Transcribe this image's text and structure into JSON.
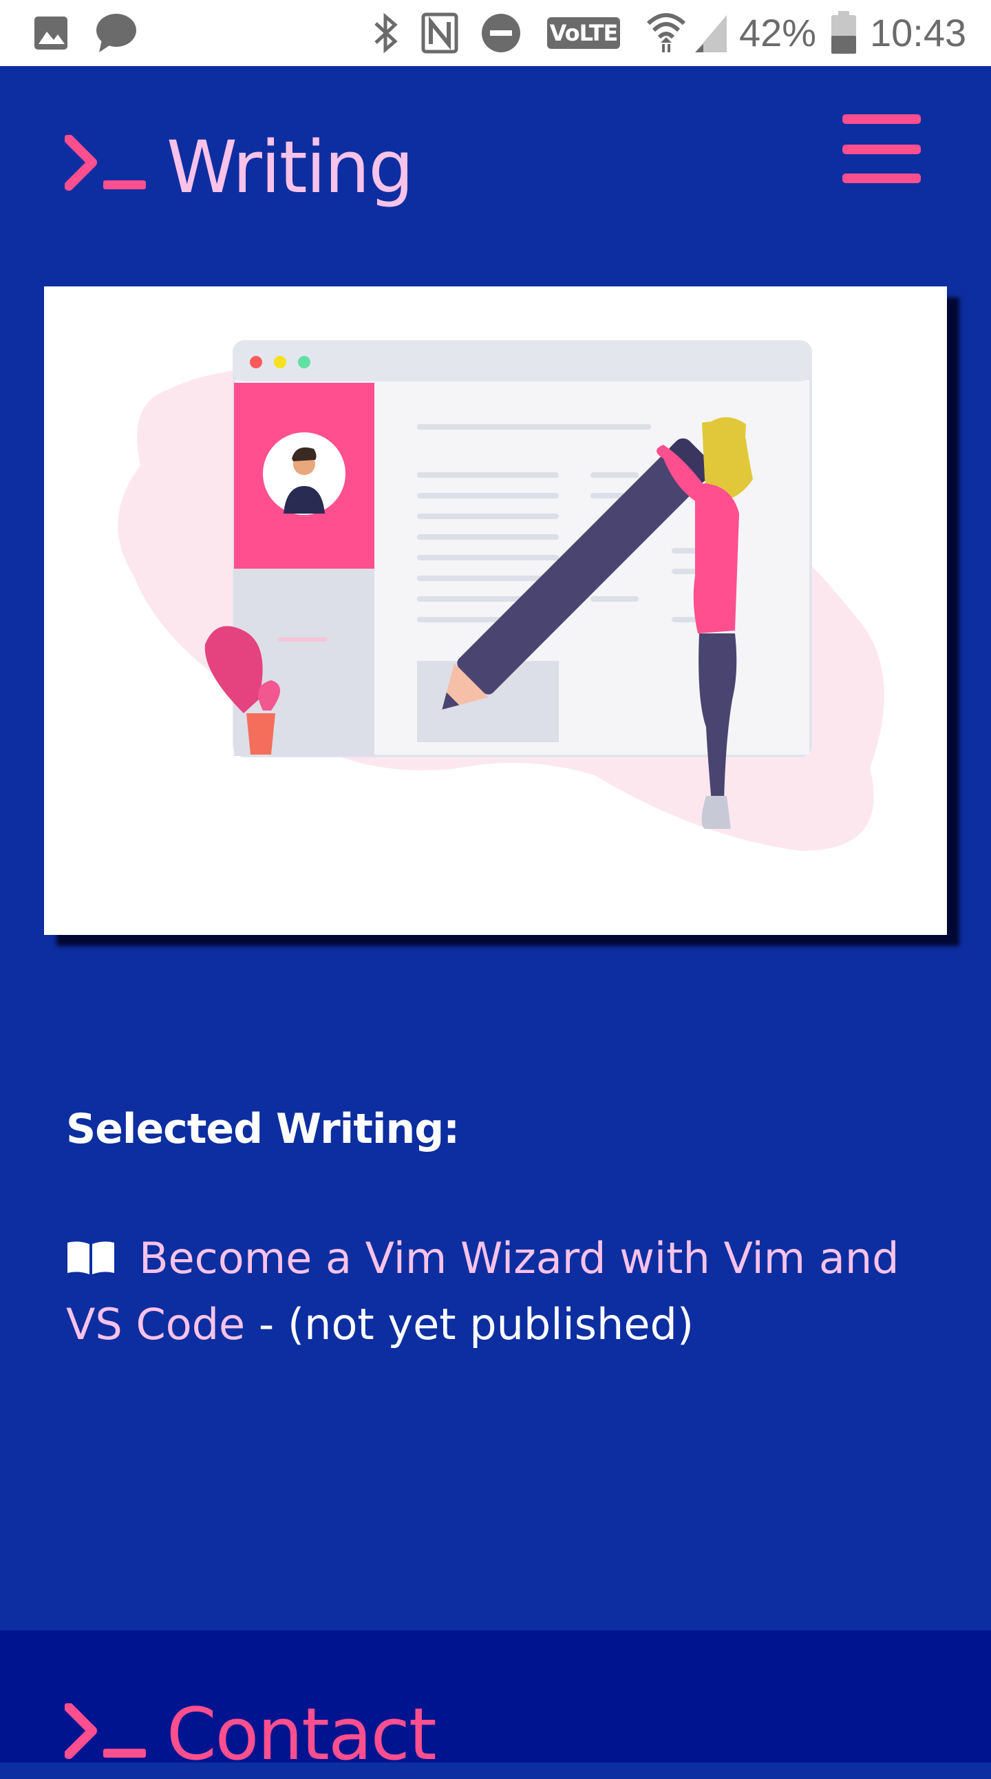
{
  "status_bar": {
    "battery_percent": "42%",
    "time": "10:43",
    "network_label": "VoLTE",
    "icons": [
      "image-icon",
      "chat-bubble-icon",
      "bluetooth-icon",
      "nfc-icon",
      "do-not-disturb-icon",
      "volte-icon",
      "wifi-icon",
      "cell-signal-icon",
      "battery-icon"
    ]
  },
  "header": {
    "prompt_symbol": ">_",
    "title": "Writing",
    "menu_icon": "hamburger-menu-icon"
  },
  "hero": {
    "illustration": "woman-writing-with-giant-pencil-illustration"
  },
  "selected_writing": {
    "heading": "Selected Writing:",
    "items": [
      {
        "icon": "book-icon",
        "link_text": "Become a Vim Wizard with Vim and VS Code",
        "note": " - (not yet published)"
      }
    ]
  },
  "footer": {
    "title": "Contact"
  },
  "colors": {
    "background": "#0d2ea0",
    "footer_background": "#001490",
    "accent_pink": "#ff4f8f",
    "light_pink": "#f9c2e8",
    "text_white": "#ffffff"
  }
}
